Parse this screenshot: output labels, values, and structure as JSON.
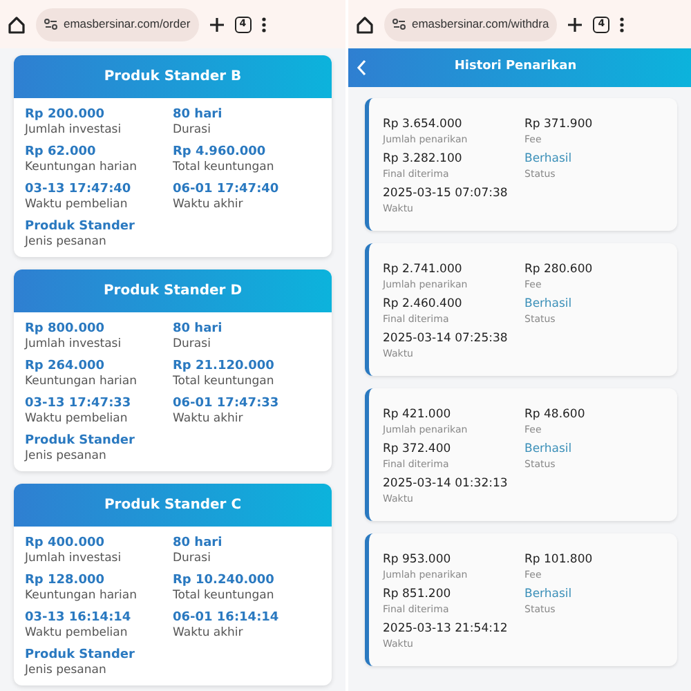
{
  "panels": [
    {
      "browser_bar": {
        "url": "emasbersinar.com/order",
        "tab_count": "4"
      },
      "orders": [
        {
          "title": "Produk Stander B",
          "fields": [
            {
              "value": "Rp 200.000",
              "label": "Jumlah investasi"
            },
            {
              "value": "80 hari",
              "label": "Durasi"
            },
            {
              "value": "Rp 62.000",
              "label": "Keuntungan harian"
            },
            {
              "value": "Rp 4.960.000",
              "label": "Total keuntungan"
            },
            {
              "value": "03-13 17:47:40",
              "label": "Waktu pembelian"
            },
            {
              "value": "06-01 17:47:40",
              "label": "Waktu akhir"
            },
            {
              "value": "Produk Stander",
              "label": "Jenis pesanan"
            }
          ]
        },
        {
          "title": "Produk Stander D",
          "fields": [
            {
              "value": "Rp 800.000",
              "label": "Jumlah investasi"
            },
            {
              "value": "80 hari",
              "label": "Durasi"
            },
            {
              "value": "Rp 264.000",
              "label": "Keuntungan harian"
            },
            {
              "value": "Rp 21.120.000",
              "label": "Total keuntungan"
            },
            {
              "value": "03-13 17:47:33",
              "label": "Waktu pembelian"
            },
            {
              "value": "06-01 17:47:33",
              "label": "Waktu akhir"
            },
            {
              "value": "Produk Stander",
              "label": "Jenis pesanan"
            }
          ]
        },
        {
          "title": "Produk Stander C",
          "fields": [
            {
              "value": "Rp 400.000",
              "label": "Jumlah investasi"
            },
            {
              "value": "80 hari",
              "label": "Durasi"
            },
            {
              "value": "Rp 128.000",
              "label": "Keuntungan harian"
            },
            {
              "value": "Rp 10.240.000",
              "label": "Total keuntungan"
            },
            {
              "value": "03-13 16:14:14",
              "label": "Waktu pembelian"
            },
            {
              "value": "06-01 16:14:14",
              "label": "Waktu akhir"
            },
            {
              "value": "Produk Stander",
              "label": "Jenis pesanan"
            }
          ]
        }
      ]
    },
    {
      "browser_bar": {
        "url": "emasbersinar.com/withdra",
        "tab_count": "4"
      },
      "header": {
        "title": "Histori Penarikan"
      },
      "withdrawals": [
        {
          "fields": [
            {
              "kind": "amount",
              "value": "Rp 3.654.000",
              "label": "Jumlah penarikan"
            },
            {
              "kind": "amount",
              "value": "Rp 371.900",
              "label": "Fee"
            },
            {
              "kind": "amount",
              "value": "Rp 3.282.100",
              "label": "Final diterima"
            },
            {
              "kind": "status",
              "value": "Berhasil",
              "label": "Status"
            },
            {
              "kind": "amount",
              "value": "2025-03-15 07:07:38",
              "label": "Waktu"
            }
          ]
        },
        {
          "fields": [
            {
              "kind": "amount",
              "value": "Rp 2.741.000",
              "label": "Jumlah penarikan"
            },
            {
              "kind": "amount",
              "value": "Rp 280.600",
              "label": "Fee"
            },
            {
              "kind": "amount",
              "value": "Rp 2.460.400",
              "label": "Final diterima"
            },
            {
              "kind": "status",
              "value": "Berhasil",
              "label": "Status"
            },
            {
              "kind": "amount",
              "value": "2025-03-14 07:25:38",
              "label": "Waktu"
            }
          ]
        },
        {
          "fields": [
            {
              "kind": "amount",
              "value": "Rp 421.000",
              "label": "Jumlah penarikan"
            },
            {
              "kind": "amount",
              "value": "Rp 48.600",
              "label": "Fee"
            },
            {
              "kind": "amount",
              "value": "Rp 372.400",
              "label": "Final diterima"
            },
            {
              "kind": "status",
              "value": "Berhasil",
              "label": "Status"
            },
            {
              "kind": "amount",
              "value": "2025-03-14 01:32:13",
              "label": "Waktu"
            }
          ]
        },
        {
          "fields": [
            {
              "kind": "amount",
              "value": "Rp 953.000",
              "label": "Jumlah penarikan"
            },
            {
              "kind": "amount",
              "value": "Rp 101.800",
              "label": "Fee"
            },
            {
              "kind": "amount",
              "value": "Rp 851.200",
              "label": "Final diterima"
            },
            {
              "kind": "status",
              "value": "Berhasil",
              "label": "Status"
            },
            {
              "kind": "amount",
              "value": "2025-03-13 21:54:12",
              "label": "Waktu"
            }
          ]
        }
      ]
    }
  ]
}
